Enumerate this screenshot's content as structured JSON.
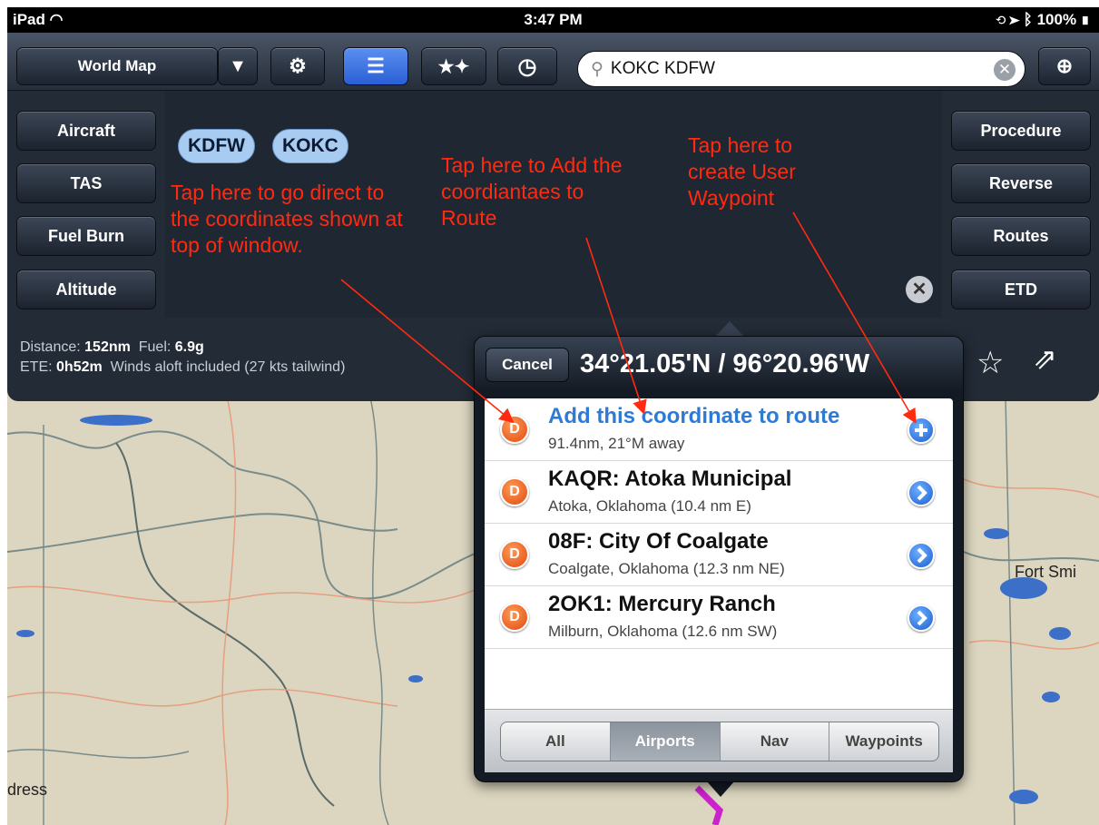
{
  "status_bar": {
    "device": "iPad",
    "time": "3:47 PM",
    "battery": "100%"
  },
  "toolbar": {
    "map_selector": "World Map",
    "search_value": "KOKC KDFW",
    "icons": [
      "dropdown-icon",
      "gear-icon",
      "list-icon",
      "favorites-icon",
      "clock-icon",
      "search-icon",
      "clear-icon",
      "locate-icon"
    ]
  },
  "left_buttons": [
    "Aircraft",
    "TAS",
    "Fuel Burn",
    "Altitude"
  ],
  "right_buttons": [
    "Procedure",
    "Reverse",
    "Routes",
    "ETD"
  ],
  "route_chips": [
    "KDFW",
    "KOKC"
  ],
  "route_info": {
    "distance_label": "Distance:",
    "distance": "152nm",
    "fuel_label": "Fuel:",
    "fuel": "6.9g",
    "ete_label": "ETE:",
    "ete": "0h52m",
    "winds": "Winds aloft included (27 kts tailwind)"
  },
  "popover": {
    "cancel": "Cancel",
    "coordinate": "34°21.05'N / 96°20.96'W",
    "rows": [
      {
        "title": "Add this coordinate to route",
        "subtitle": "91.4nm, 21°M away",
        "badge": "D",
        "accessory": "plus"
      },
      {
        "title": "KAQR: Atoka Municipal",
        "subtitle": "Atoka, Oklahoma  (10.4 nm E)",
        "badge": "D",
        "accessory": "chevron"
      },
      {
        "title": "08F: City Of Coalgate",
        "subtitle": "Coalgate, Oklahoma  (12.3 nm NE)",
        "badge": "D",
        "accessory": "chevron"
      },
      {
        "title": "2OK1: Mercury Ranch",
        "subtitle": "Milburn, Oklahoma  (12.6 nm SW)",
        "badge": "D",
        "accessory": "chevron"
      }
    ],
    "segments": [
      "All",
      "Airports",
      "Nav",
      "Waypoints"
    ],
    "selected_segment": "Airports"
  },
  "annotations": {
    "direct": "Tap here to go direct to the coordinates shown at top of window.",
    "route": "Tap here to Add the coordiantaes to Route",
    "waypoint": "Tap here to create User Waypoint",
    "color": "#ff2a10"
  },
  "map_labels": [
    "Fort Smi",
    "dress"
  ]
}
